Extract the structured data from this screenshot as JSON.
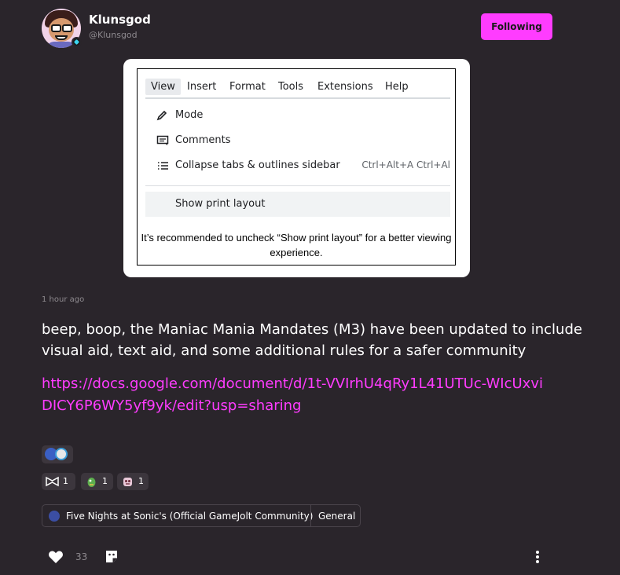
{
  "header": {
    "username": "Klunsgod",
    "handle": "@Klunsgod",
    "follow_label": "Following"
  },
  "screenshot": {
    "menu": [
      "View",
      "Insert",
      "Format",
      "Tools",
      "Extensions",
      "Help"
    ],
    "items": [
      {
        "label": "Mode",
        "icon": "pencil-icon",
        "shortcut": ""
      },
      {
        "label": "Comments",
        "icon": "comment-icon",
        "shortcut": ""
      },
      {
        "label": "Collapse tabs & outlines sidebar",
        "icon": "list-icon",
        "shortcut": "Ctrl+Alt+A Ctrl+Al"
      },
      {
        "label": "Show print layout",
        "icon": "",
        "shortcut": ""
      }
    ],
    "caption": "It’s recommended to uncheck “Show print layout” for a better viewing experience."
  },
  "post": {
    "timestamp": "1 hour ago",
    "body": "beep, boop, the Maniac Mania Mandates (M3) have been updated to include visual aid, text aid, and some additional rules for a safer community",
    "link": "https://docs.google.com/document/d/1t-VVIrhU4qRy1L41UTUc-WIcUxviDICY6P6WY5yf9yk/edit?usp=sharing"
  },
  "reactions": [
    {
      "icon": "bowtie-icon",
      "count": "1"
    },
    {
      "icon": "creature-icon",
      "count": "1"
    },
    {
      "icon": "robot-icon",
      "count": "1"
    }
  ],
  "community": {
    "name": "Five Nights at Sonic's (Official GameJolt Community)",
    "channel": "General"
  },
  "footer": {
    "like_count": "33"
  },
  "colors": {
    "accent": "#ff3cff",
    "background": "#2a252b"
  }
}
